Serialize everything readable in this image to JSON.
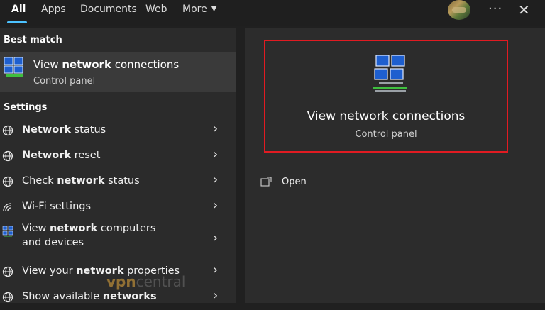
{
  "tabs": [
    {
      "label": "All",
      "active": true
    },
    {
      "label": "Apps"
    },
    {
      "label": "Documents"
    },
    {
      "label": "Web"
    },
    {
      "label": "More"
    }
  ],
  "best_match": {
    "header": "Best match",
    "title_prefix": "View ",
    "title_bold": "network",
    "title_suffix": " connections",
    "subtitle": "Control panel",
    "icon": "network-connections-icon"
  },
  "settings": {
    "header": "Settings",
    "items": [
      {
        "pre": "",
        "bold": "Network",
        "post": " status",
        "icon": "globe-network-icon"
      },
      {
        "pre": "",
        "bold": "Network",
        "post": " reset",
        "icon": "globe-network-icon"
      },
      {
        "pre": "Check ",
        "bold": "network",
        "post": " status",
        "icon": "globe-network-icon"
      },
      {
        "pre": "Wi-Fi settings",
        "bold": "",
        "post": "",
        "icon": "wifi-icon"
      },
      {
        "pre": "View ",
        "bold": "network",
        "post": " computers and devices",
        "icon": "network-computers-icon"
      },
      {
        "pre": "View your ",
        "bold": "network",
        "post": " properties",
        "icon": "globe-network-icon"
      },
      {
        "pre": "Show available ",
        "bold": "networks",
        "post": "",
        "icon": "globe-network-icon"
      }
    ]
  },
  "preview": {
    "title": "View network connections",
    "subtitle": "Control panel",
    "open_label": "Open"
  },
  "watermark": {
    "vpn": "vpn",
    "central": "central"
  },
  "colors": {
    "accent": "#4cc2ff",
    "highlight_border": "#e11b22"
  }
}
